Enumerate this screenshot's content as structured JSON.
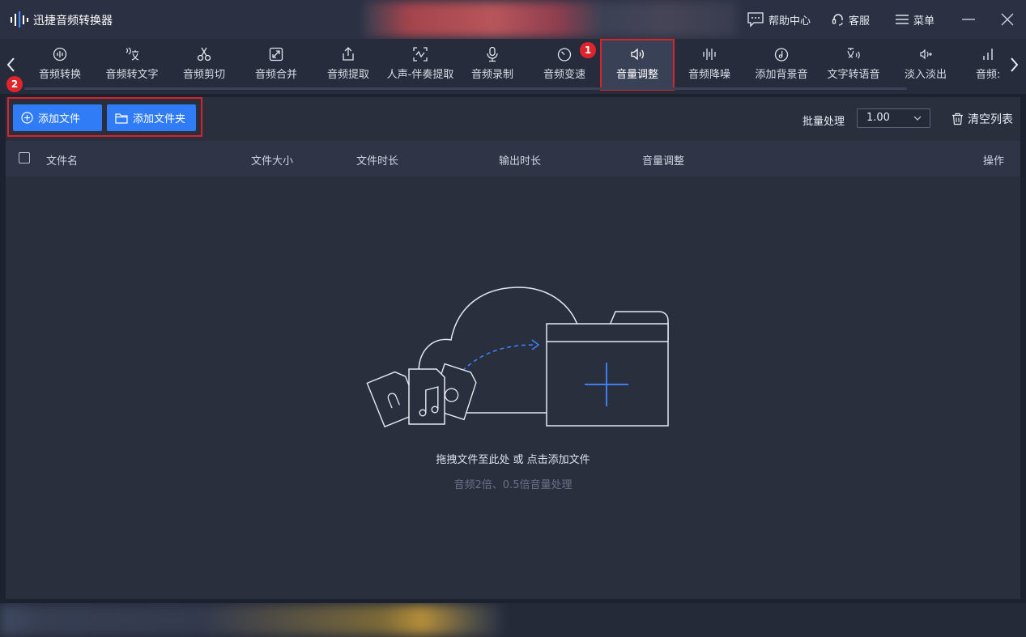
{
  "app": {
    "title": "迅捷音频转换器"
  },
  "titlebar": {
    "help_label": "帮助中心",
    "service_label": "客服",
    "menu_label": "菜单"
  },
  "tabs": [
    {
      "label": "音频转换",
      "icon": "audio-convert-icon"
    },
    {
      "label": "音频转文字",
      "icon": "speech-to-text-icon"
    },
    {
      "label": "音频剪切",
      "icon": "scissors-icon"
    },
    {
      "label": "音频合并",
      "icon": "merge-icon"
    },
    {
      "label": "音频提取",
      "icon": "export-icon"
    },
    {
      "label": "人声-伴奏提取",
      "icon": "vocal-icon"
    },
    {
      "label": "音频录制",
      "icon": "microphone-icon"
    },
    {
      "label": "音频变速",
      "icon": "speed-icon"
    },
    {
      "label": "音量调整",
      "icon": "volume-icon",
      "active": true
    },
    {
      "label": "音频降噪",
      "icon": "waveform-icon"
    },
    {
      "label": "添加背景音",
      "icon": "music-disc-icon"
    },
    {
      "label": "文字转语音",
      "icon": "text-to-speech-icon"
    },
    {
      "label": "淡入淡出",
      "icon": "fade-icon"
    },
    {
      "label": "音频:",
      "icon": "bars-icon"
    }
  ],
  "badges": {
    "step1": "1",
    "step2": "2"
  },
  "actions": {
    "add_file": "添加文件",
    "add_folder": "添加文件夹",
    "batch_label": "批量处理",
    "batch_value": "1.00",
    "clear_list": "清空列表"
  },
  "table": {
    "columns": {
      "name": "文件名",
      "size": "文件大小",
      "duration": "文件时长",
      "output_duration": "输出时长",
      "volume": "音量调整",
      "ops": "操作"
    }
  },
  "empty": {
    "hint": "拖拽文件至此处 或 点击添加文件",
    "sub": "音频2倍、0.5倍音量处理"
  },
  "colors": {
    "accent": "#2f7cf6",
    "highlight": "#d8232a",
    "background": "#1c2230"
  }
}
